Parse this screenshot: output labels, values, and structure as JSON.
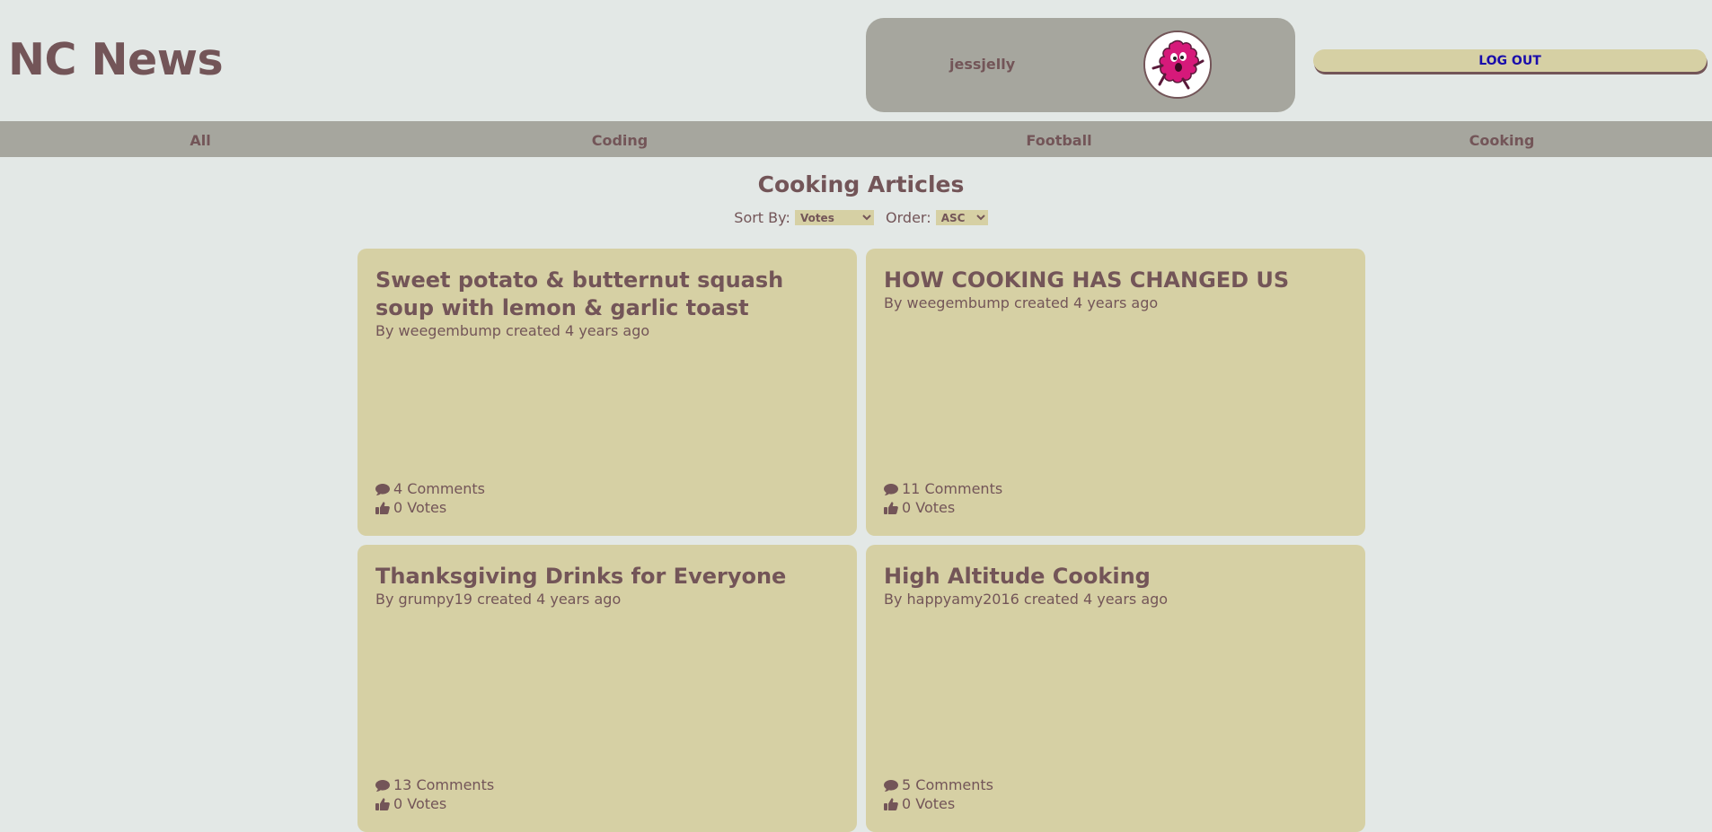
{
  "app": {
    "title": "NC News"
  },
  "user": {
    "username": "jessjelly",
    "avatar_icon": "pink-monster-avatar",
    "logout_label": "LOG OUT"
  },
  "nav": {
    "items": [
      {
        "label": "All"
      },
      {
        "label": "Coding"
      },
      {
        "label": "Football"
      },
      {
        "label": "Cooking"
      }
    ]
  },
  "page": {
    "heading": "Cooking Articles",
    "sort_label": "Sort By:",
    "sort_value": "Votes",
    "order_label": "Order:",
    "order_value": "ASC"
  },
  "articles": [
    {
      "title": "Sweet potato & butternut squash soup with lemon & garlic toast",
      "byline": "By weegembump created 4 years ago",
      "comments": "4 Comments",
      "votes": "0 Votes"
    },
    {
      "title": "HOW COOKING HAS CHANGED US",
      "byline": "By weegembump created 4 years ago",
      "comments": "11 Comments",
      "votes": "0 Votes"
    },
    {
      "title": "Thanksgiving Drinks for Everyone",
      "byline": "By grumpy19 created 4 years ago",
      "comments": "13 Comments",
      "votes": "0 Votes"
    },
    {
      "title": "High Altitude Cooking",
      "byline": "By happyamy2016 created 4 years ago",
      "comments": "5 Comments",
      "votes": "0 Votes"
    }
  ],
  "icons": {
    "comment": "comment-icon",
    "votes": "thumbs-up-icon"
  },
  "colors": {
    "background": "#e3e8e6",
    "panel": "#a6a69e",
    "card": "#d6d0a4",
    "text": "#735558",
    "logout_text": "#1a0dab",
    "avatar_monster": "#d6197a"
  }
}
